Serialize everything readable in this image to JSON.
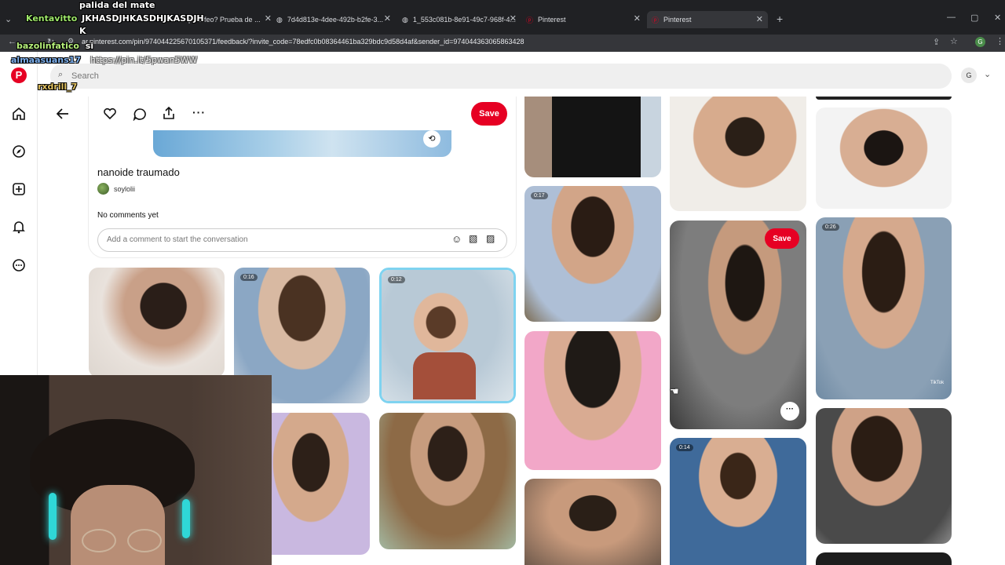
{
  "browser": {
    "tabs": [
      {
        "label": "po o feo? Prueba de ..."
      },
      {
        "label": "7d4d813e-4dee-492b-b2fe-3..."
      },
      {
        "label": "1_553c081b-8e91-49c7-968f-4..."
      },
      {
        "label": "Pinterest"
      },
      {
        "label": "Pinterest"
      }
    ],
    "new_tab": "+",
    "url": "ar.pinterest.com/pin/974044225670105371/feedback/?invite_code=78edfc0b08364461ba329bdc9d58d4af&sender_id=974044363065863428",
    "profile_initial": "G"
  },
  "header": {
    "search_placeholder": "Search",
    "avatar_initial": "G"
  },
  "pin": {
    "title": "nanoide traumado",
    "author": "soylolii",
    "no_comments": "No comments yet",
    "comment_placeholder": "Add a comment to start the conversation",
    "save_label": "Save"
  },
  "tiles": {
    "save_label": "Save",
    "durations": [
      "0:16",
      "0:12",
      "0:17",
      "0:26",
      "0:14"
    ],
    "tiktok_label": "TikTok"
  },
  "stream_overlays": [
    {
      "user": "Kentavitto",
      "message": "JKHASDJHKASDHJKASDJH"
    },
    {
      "user": "",
      "message": "palida del mate"
    },
    {
      "user": "",
      "message": "K"
    },
    {
      "user": "bazolinfatico",
      "message": "si"
    },
    {
      "user": "almaasuans17",
      "message": "https://pin.it/5pwan5WW"
    },
    {
      "user": "rxdrill_7",
      "message": ""
    }
  ],
  "colors": {
    "pinterest_red": "#e60023",
    "chrome_dark": "#202124",
    "selected_tile_border": "#7fd3f0"
  }
}
